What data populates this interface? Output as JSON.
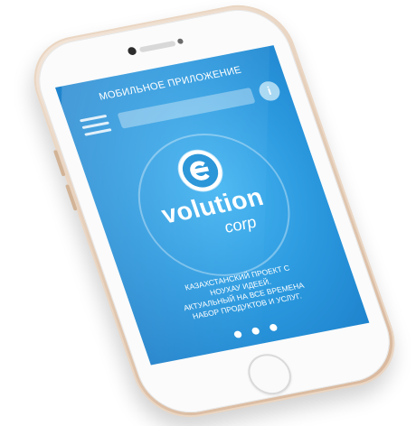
{
  "app": {
    "title": "МОБИЛЬНОЕ ПРИЛОЖЕНИЕ",
    "info_icon_glyph": "i"
  },
  "brand": {
    "name": "volution",
    "sub": "corp"
  },
  "description": {
    "lines": [
      "КАЗАХСТАНСКИЙ ПРОЕКТ С",
      "НОУХАУ ИДЕЕЙ.",
      "АКТУАЛЬНЫЙ НА ВСЕ ВРЕМЕНА",
      "НАБОР ПРОДУКТОВ И УСЛУГ."
    ]
  },
  "pagination": {
    "total_dots": 3
  },
  "icons": {
    "menu": "menu-icon",
    "info": "info-icon",
    "logo": "evolution-logo-icon"
  },
  "colors": {
    "screen_blue": "#2a97dd",
    "phone_gold": "#e3cbb5",
    "logo_blue": "#1d8fd6"
  }
}
